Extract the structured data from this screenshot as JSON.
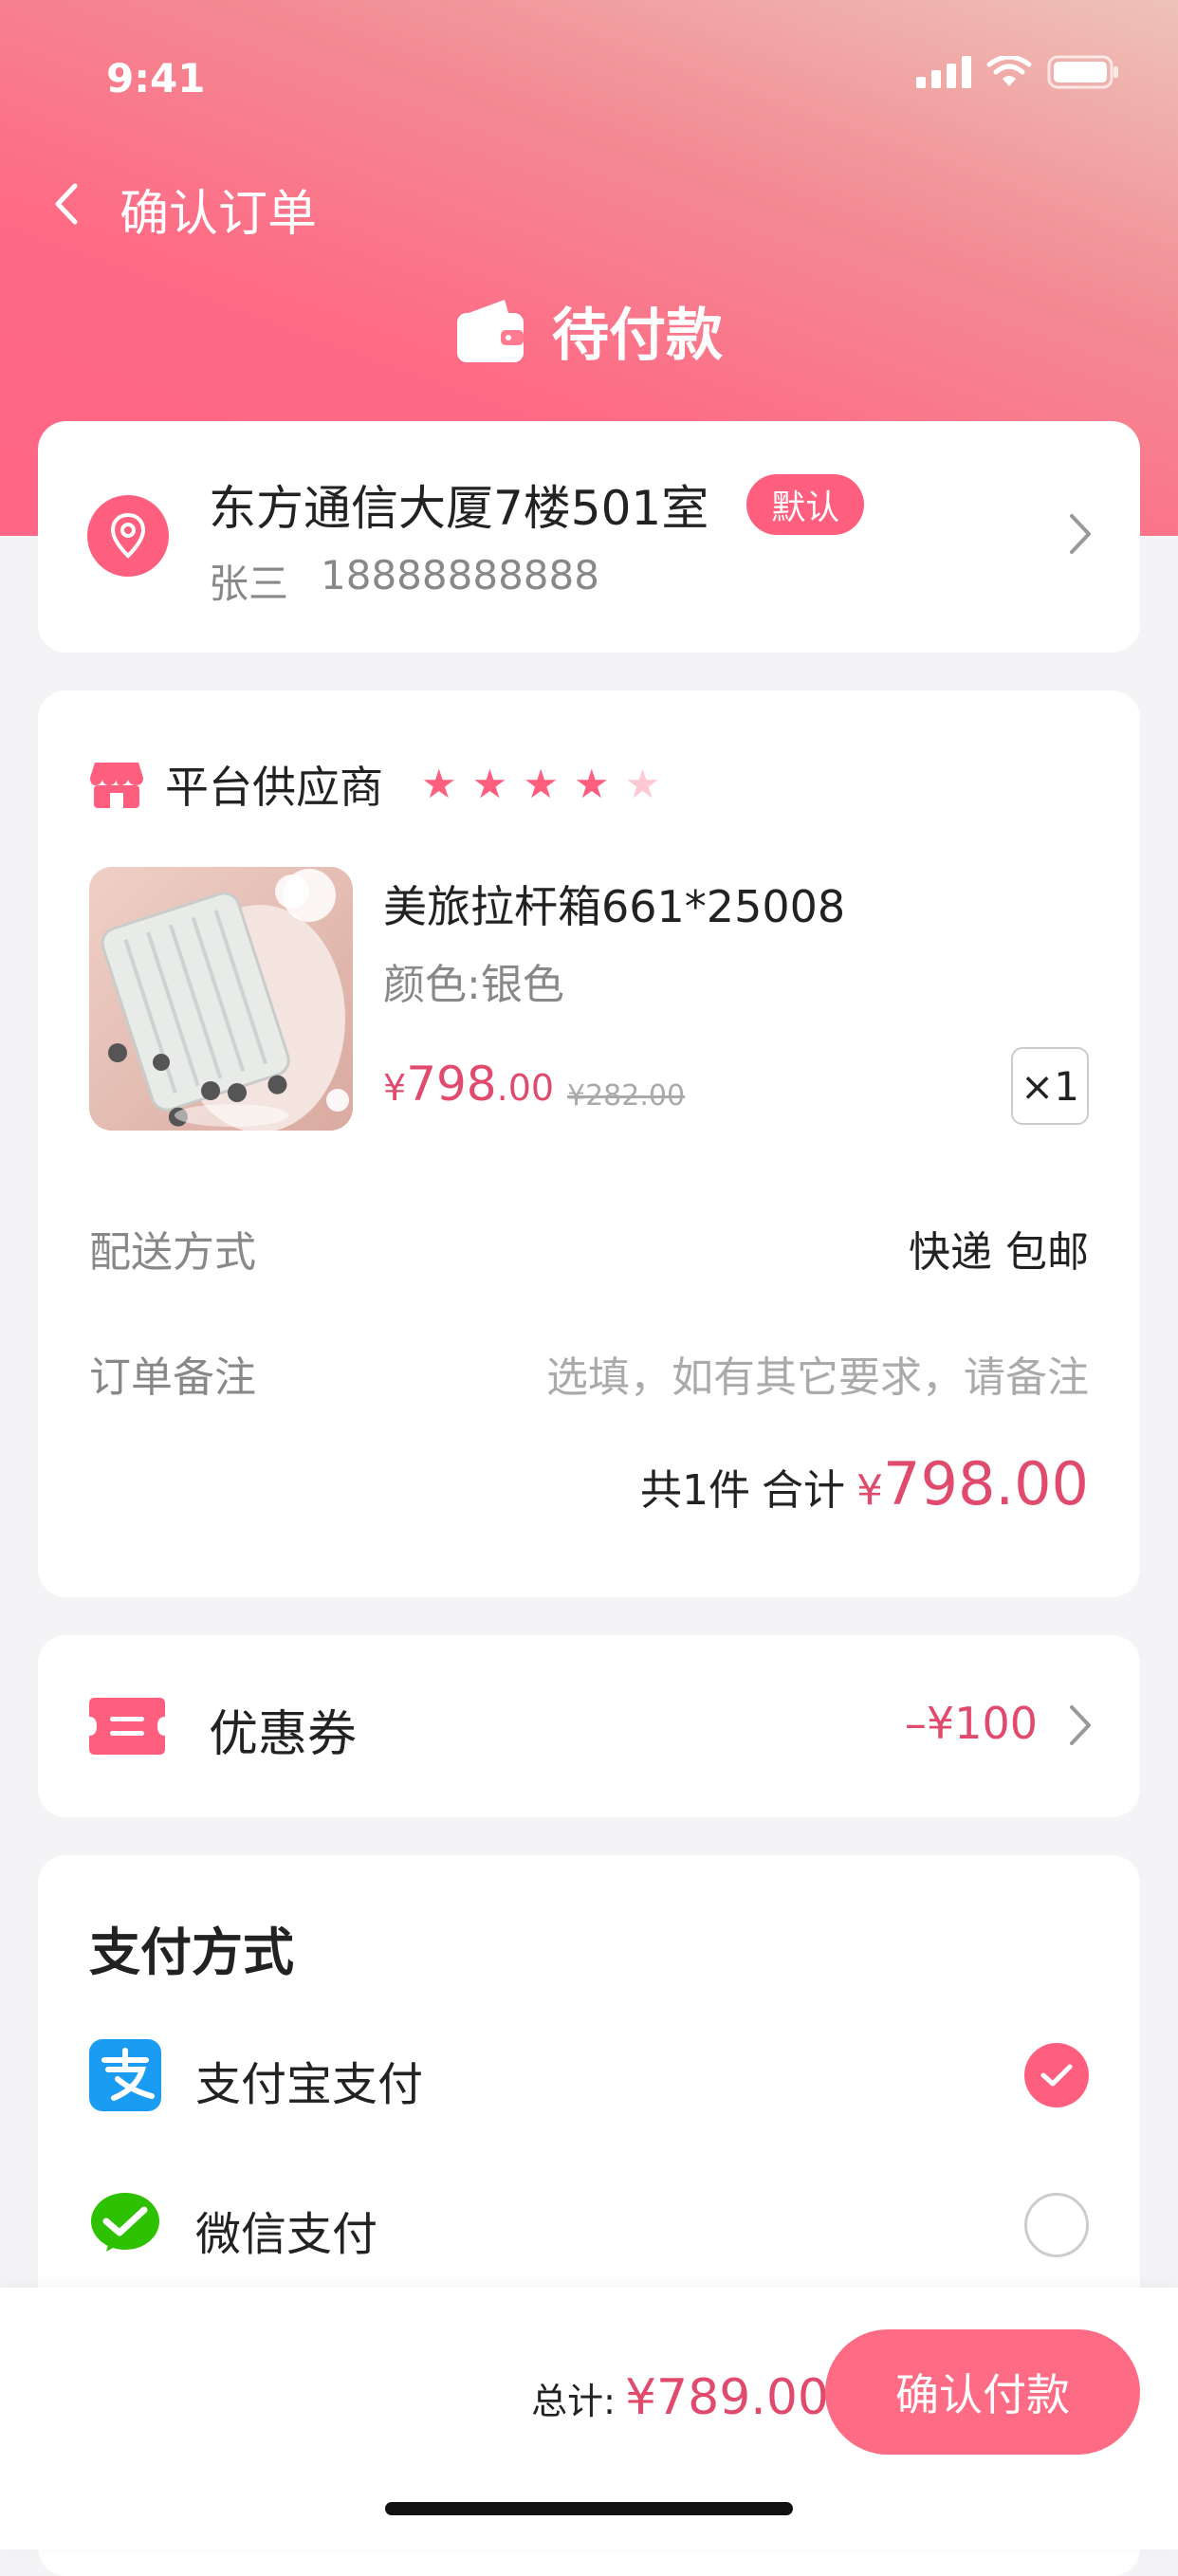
{
  "status_bar": {
    "time": "9:41"
  },
  "nav": {
    "title": "确认订单"
  },
  "order_status": "待付款",
  "address": {
    "line": "东方通信大厦7楼501室",
    "badge": "默认",
    "name": "张三",
    "phone": "18888888888"
  },
  "shop": {
    "name": "平台供应商",
    "rating": 4,
    "max_rating": 5
  },
  "product": {
    "title": "美旅拉杆箱661*25008",
    "spec": "颜色:银色",
    "price_symbol": "¥",
    "price_int": "798",
    "price_dec": ".00",
    "old_price": "¥282.00",
    "quantity": "×1"
  },
  "delivery": {
    "label": "配送方式",
    "value": "快递 包邮"
  },
  "remark": {
    "label": "订单备注",
    "placeholder": "选填，如有其它要求，请备注"
  },
  "summary": {
    "count_text": "共1件",
    "total_label": "合计",
    "symbol": "¥",
    "total": "798.00"
  },
  "coupon": {
    "label": "优惠券",
    "value": "–¥100"
  },
  "payment": {
    "title": "支付方式",
    "methods": [
      {
        "name": "支付宝支付",
        "selected": true
      },
      {
        "name": "微信支付",
        "selected": false
      }
    ]
  },
  "footer": {
    "total_label": "总计:",
    "total_value": "¥789.00",
    "pay_button": "确认付款"
  },
  "colors": {
    "accent": "#fe5f7e",
    "price": "#e04a6c",
    "alipay": "#1a9cf2",
    "wechat": "#2dc100"
  }
}
